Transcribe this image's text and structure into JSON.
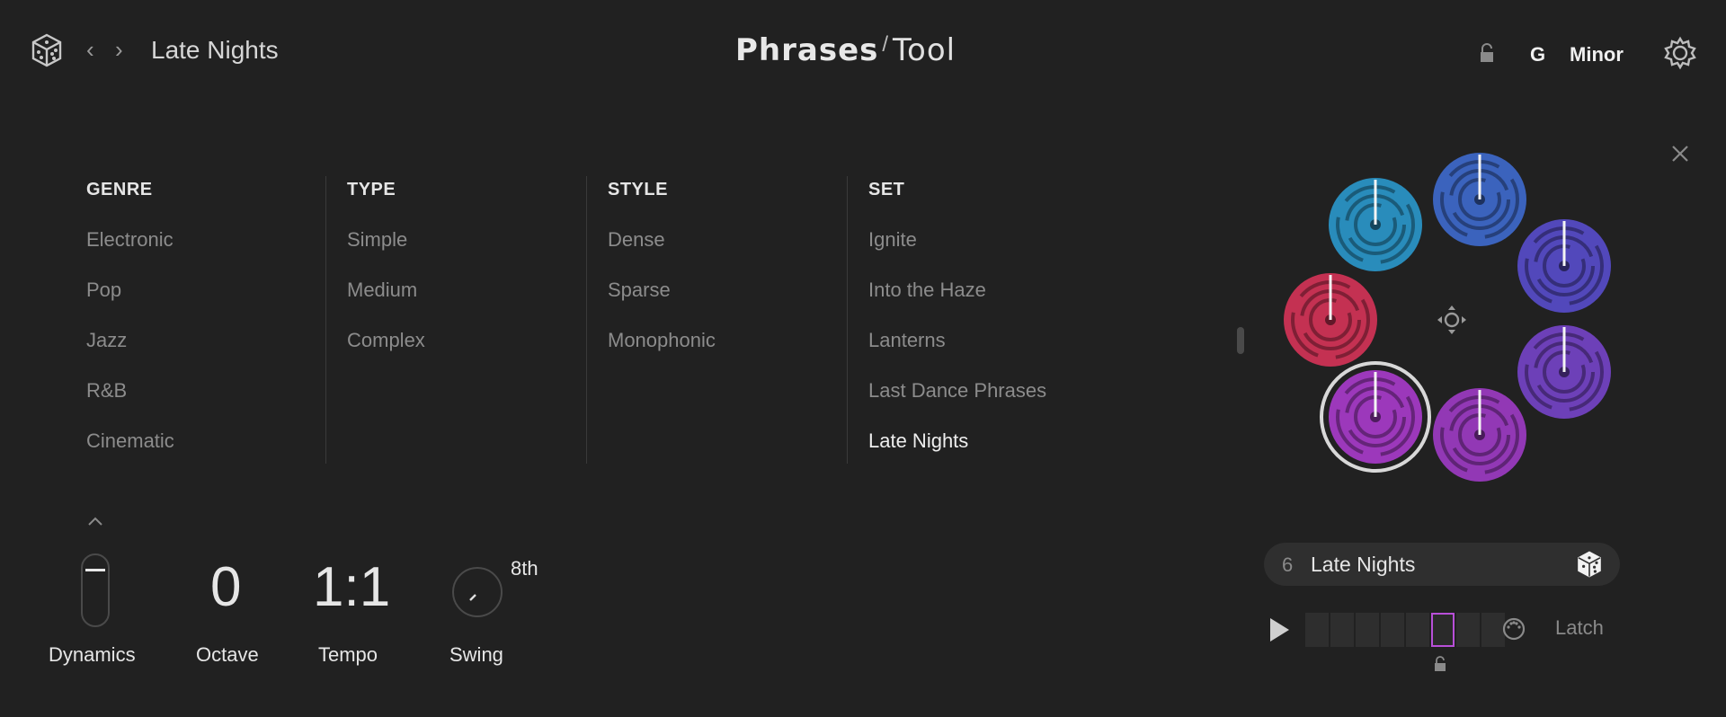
{
  "header": {
    "preset_name": "Late Nights",
    "logo_bold": "Phrases",
    "logo_light": "Tool",
    "key_root": "G",
    "key_scale": "Minor"
  },
  "browser": {
    "columns": [
      {
        "heading": "GENRE",
        "items": [
          "Electronic",
          "Pop",
          "Jazz",
          "R&B",
          "Cinematic"
        ]
      },
      {
        "heading": "TYPE",
        "items": [
          "Simple",
          "Medium",
          "Complex"
        ]
      },
      {
        "heading": "STYLE",
        "items": [
          "Dense",
          "Sparse",
          "Monophonic"
        ]
      },
      {
        "heading": "SET",
        "items": [
          "Ignite",
          "Into the Haze",
          "Lanterns",
          "Last Dance Phrases",
          "Late Nights"
        ],
        "active_index": 4
      }
    ]
  },
  "controls": {
    "dynamics_label": "Dynamics",
    "octave_value": "0",
    "octave_label": "Octave",
    "tempo_value": "1:1",
    "tempo_label": "Tempo",
    "swing_label": "Swing",
    "swing_division": "8th"
  },
  "phrase_wheel": {
    "selected_index": 6,
    "colors": [
      "#2a9fd6",
      "#3f6fd8",
      "#5b4fd6",
      "#7a45d2",
      "#b23cd6",
      "#a63ccf",
      "#e0345a"
    ]
  },
  "player": {
    "number": "6",
    "name": "Late Nights",
    "latch_label": "Latch",
    "steps": 8,
    "active_step": 5
  }
}
